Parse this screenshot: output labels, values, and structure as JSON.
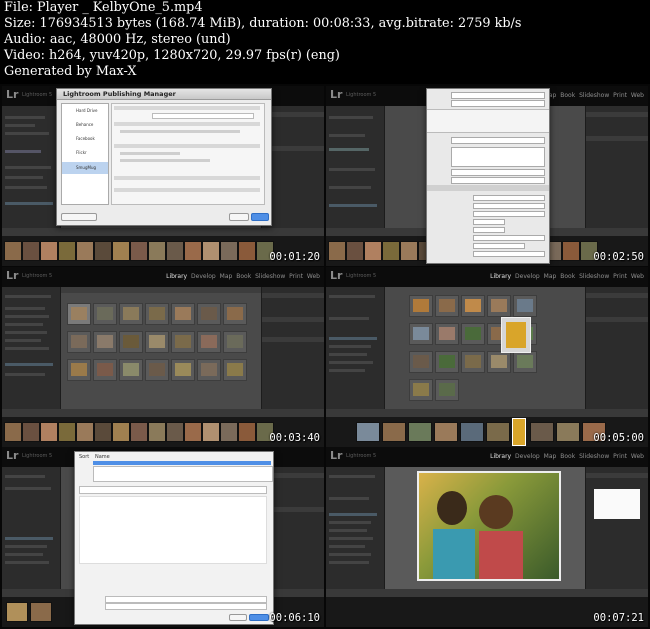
{
  "header": {
    "lines": [
      "File: Player _ KelbyOne_5.mp4",
      "Size: 176934513 bytes (168.74 MiB), duration: 00:08:33, avg.bitrate: 2759 kb/s",
      "Audio: aac, 48000 Hz, stereo (und)",
      "Video: h264, yuv420p, 1280x720, 29.97 fps(r) (eng)",
      "Generated by Max-X"
    ]
  },
  "app": {
    "logo": "Lr",
    "name": "Lightroom 5",
    "modules": [
      "Library",
      "Develop",
      "Map",
      "Book",
      "Slideshow",
      "Print",
      "Web"
    ],
    "active_module": "Library"
  },
  "dialogs": {
    "publishing_manager_title": "Lightroom Publishing Manager",
    "publishing_manager_services": [
      "Hard Drive",
      "Behance",
      "Facebook",
      "Flickr",
      "SmugMug"
    ],
    "publishing_manager_buttons": [
      "Plug-in Manager...",
      "Cancel",
      "Save"
    ],
    "naming_dialog_header": [
      "Sort",
      "Name"
    ]
  },
  "thumbnails": [
    {
      "timestamp": "00:01:20"
    },
    {
      "timestamp": "00:02:50"
    },
    {
      "timestamp": "00:03:40"
    },
    {
      "timestamp": "00:05:00"
    },
    {
      "timestamp": "00:06:10"
    },
    {
      "timestamp": "00:07:21"
    }
  ],
  "colors": {
    "lr_panel": "#2c2c2c",
    "lr_center": "#4a4a4a",
    "accent_blue": "#4f8fe6",
    "filmstrip_selected": "#d9a52a"
  }
}
